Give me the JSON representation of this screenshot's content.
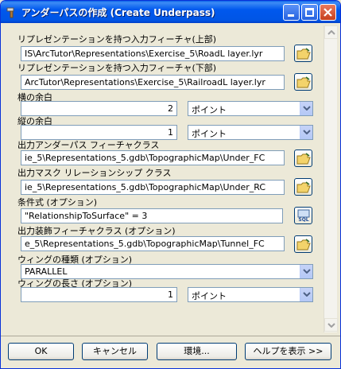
{
  "window": {
    "title": "アンダーパスの作成 (Create Underpass)"
  },
  "fields": {
    "road_label": "リプレゼンテーションを持つ入力フィーチャ(上部)",
    "road_value": "IS\\ArcTutor\\Representations\\Exercise_5\\RoadL layer.lyr",
    "rail_label": "リプレゼンテーションを持つ入力フィーチャ(下部)",
    "rail_value": "ArcTutor\\Representations\\Exercise_5\\RailroadL layer.lyr",
    "hmargin_label": "横の余白",
    "hmargin_value": "2",
    "hmargin_unit": "ポイント",
    "vmargin_label": "縦の余白",
    "vmargin_value": "1",
    "vmargin_unit": "ポイント",
    "out_fc_label": "出力アンダーパス フィーチャクラス",
    "out_fc_value": "ie_5\\Representations_5.gdb\\TopographicMap\\Under_FC",
    "out_rc_label": "出力マスク リレーションシップ クラス",
    "out_rc_value": "ie_5\\Representations_5.gdb\\TopographicMap\\Under_RC",
    "where_label": "条件式 (オプション)",
    "where_value": "\"RelationshipToSurface\" = 3",
    "deco_label": "出力装飾フィーチャクラス (オプション)",
    "deco_value": "e_5\\Representations_5.gdb\\TopographicMap\\Tunnel_FC",
    "wing_type_label": "ウィングの種類 (オプション)",
    "wing_type_value": "PARALLEL",
    "wing_len_label": "ウィングの長さ (オプション)",
    "wing_len_value": "1",
    "wing_len_unit": "ポイント"
  },
  "sql_button_label": "SQL",
  "buttons": {
    "ok": "OK",
    "cancel": "キャンセル",
    "env": "環境...",
    "help": "ヘルプを表示 >>"
  }
}
